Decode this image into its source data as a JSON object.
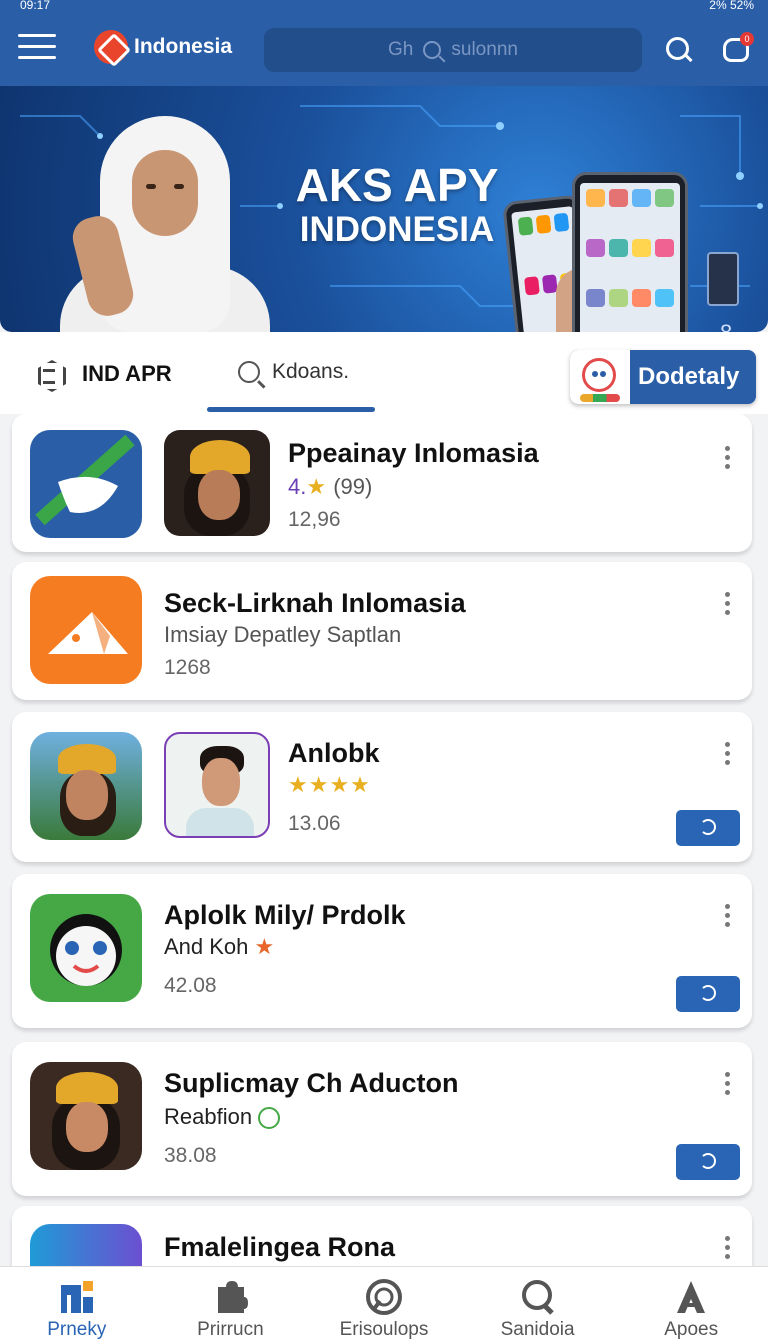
{
  "status_bar": {
    "left": "09:17",
    "right": "2% 52%"
  },
  "header": {
    "brand": "Indonesia",
    "search_placeholder": "Gh",
    "search_query": "sulonnn",
    "notification_count": "0"
  },
  "banner": {
    "title_line1": "AKS APY",
    "title_line2": "INDONESIA",
    "side_number": "8"
  },
  "tabs": {
    "primary_label": "IND APR",
    "search_label": "Kdoans.",
    "promo_label": "Dodetaly"
  },
  "apps": [
    {
      "title": "Ppeainay Inlomasia",
      "rating": "4.",
      "reviews": "(99)",
      "size": "12,96"
    },
    {
      "title": "Seck-Lirknah Inlomasia",
      "subtitle": "Imsiay Depatley Saptlan",
      "size": "1268"
    },
    {
      "title": "Anlobk",
      "size": "13.06"
    },
    {
      "title": "Aplolk Mily/ Prdolk",
      "subtitle": "And Koh",
      "size": "42.08"
    },
    {
      "title": "Suplicmay Ch Aducton",
      "subtitle": "Reabfion",
      "size": "38.08"
    },
    {
      "title": "Fmalelingea Rona"
    }
  ],
  "bottom_nav": [
    {
      "label": "Prneky",
      "icon": "apps-grid-icon"
    },
    {
      "label": "Prirrucn",
      "icon": "puzzle-icon"
    },
    {
      "label": "Erisoulops",
      "icon": "compass-icon"
    },
    {
      "label": "Sanidoia",
      "icon": "chat-search-icon"
    },
    {
      "label": "Apoes",
      "icon": "user-icon"
    }
  ],
  "colors": {
    "primary": "#2a5fa8",
    "accent": "#e8452c"
  }
}
